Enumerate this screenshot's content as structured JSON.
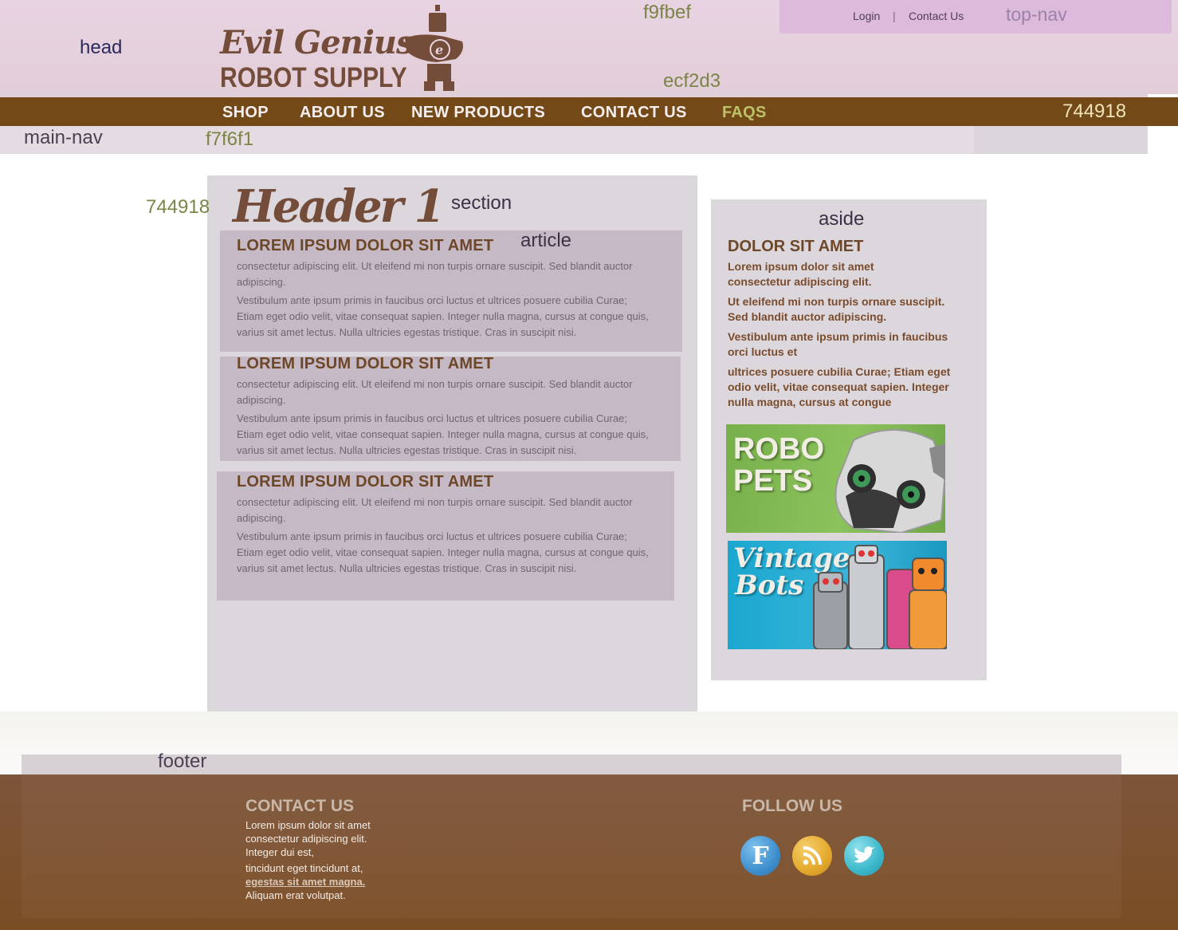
{
  "labels": {
    "head": "head",
    "color_head_top": "f9fbef",
    "color_head_bottom": "ecf2d3",
    "main_nav": "main-nav",
    "color_nav_under": "f7f6f1",
    "color_nav_right": "744918",
    "color_section_left": "744918",
    "section": "section",
    "article": "article",
    "aside": "aside",
    "footer": "footer"
  },
  "top_nav": {
    "login": "Login",
    "separator": "|",
    "contact": "Contact Us",
    "label": "top-nav"
  },
  "logo": {
    "line1": "Evil Genius",
    "line2": "ROBOT SUPPLY",
    "badge": "e"
  },
  "main_nav": {
    "items": [
      "SHOP",
      "ABOUT US",
      "NEW PRODUCTS",
      "CONTACT US",
      "FAQS"
    ]
  },
  "section": {
    "heading": "Header 1",
    "articles": [
      {
        "title": "LOREM IPSUM DOLOR SIT AMET",
        "p1": "consectetur adipiscing elit. Ut eleifend mi non turpis ornare suscipit. Sed blandit auctor adipiscing.",
        "p2": "Vestibulum ante ipsum primis in faucibus orci luctus et ultrices posuere cubilia Curae; Etiam eget odio velit, vitae consequat sapien. Integer nulla magna, cursus at congue quis, varius sit amet lectus. Nulla ultricies egestas tristique. Cras in suscipit nisi."
      },
      {
        "title": "LOREM IPSUM DOLOR SIT AMET",
        "p1": "consectetur adipiscing elit. Ut eleifend mi non turpis ornare suscipit. Sed blandit auctor adipiscing.",
        "p2": "Vestibulum ante ipsum primis in faucibus orci luctus et ultrices posuere cubilia Curae; Etiam eget odio velit, vitae consequat sapien. Integer nulla magna, cursus at congue quis, varius sit amet lectus. Nulla ultricies egestas tristique. Cras in suscipit nisi."
      },
      {
        "title": "LOREM IPSUM DOLOR SIT AMET",
        "p1": "consectetur adipiscing elit. Ut eleifend mi non turpis ornare suscipit. Sed blandit auctor adipiscing.",
        "p2": "Vestibulum ante ipsum primis in faucibus orci luctus et ultrices posuere cubilia Curae; Etiam eget odio velit, vitae consequat sapien. Integer nulla magna, cursus at congue quis, varius sit amet lectus. Nulla ultricies egestas tristique. Cras in suscipit nisi."
      }
    ]
  },
  "aside": {
    "title": "DOLOR SIT AMET",
    "p1": "Lorem ipsum dolor sit amet consectetur adipiscing elit.",
    "p2": "Ut eleifend mi non turpis ornare suscipit. Sed blandit auctor adipiscing.",
    "p3": "Vestibulum ante ipsum primis in faucibus orci luctus et",
    "p4": "ultrices posuere cubilia Curae; Etiam eget odio velit, vitae consequat sapien. Integer nulla magna, cursus at congue",
    "promo1_line1": "ROBO",
    "promo1_line2": "PETS",
    "promo2_line1": "Vintage",
    "promo2_line2": "Bots"
  },
  "footer": {
    "contact_title": "CONTACT US",
    "contact_lines": [
      "Lorem ipsum dolor sit amet",
      "consectetur adipiscing elit.",
      "Integer dui est,",
      "tincidunt eget tincidunt at,",
      "egestas sit amet magna.",
      "Aliquam erat volutpat."
    ],
    "follow_title": "FOLLOW US",
    "social": [
      {
        "icon": "facebook-icon",
        "glyph": "F",
        "color": "#3f8fce"
      },
      {
        "icon": "rss-icon",
        "glyph": "",
        "color": "#e4a92c"
      },
      {
        "icon": "twitter-icon",
        "glyph": "",
        "color": "#3cb8cb"
      }
    ]
  },
  "colors": {
    "brown": "#744918",
    "logo_brown": "#744d3a",
    "faqs_highlight": "#bcc26a",
    "section_bg": "#dcd6dd",
    "article_bg": "#c5b9c5"
  }
}
